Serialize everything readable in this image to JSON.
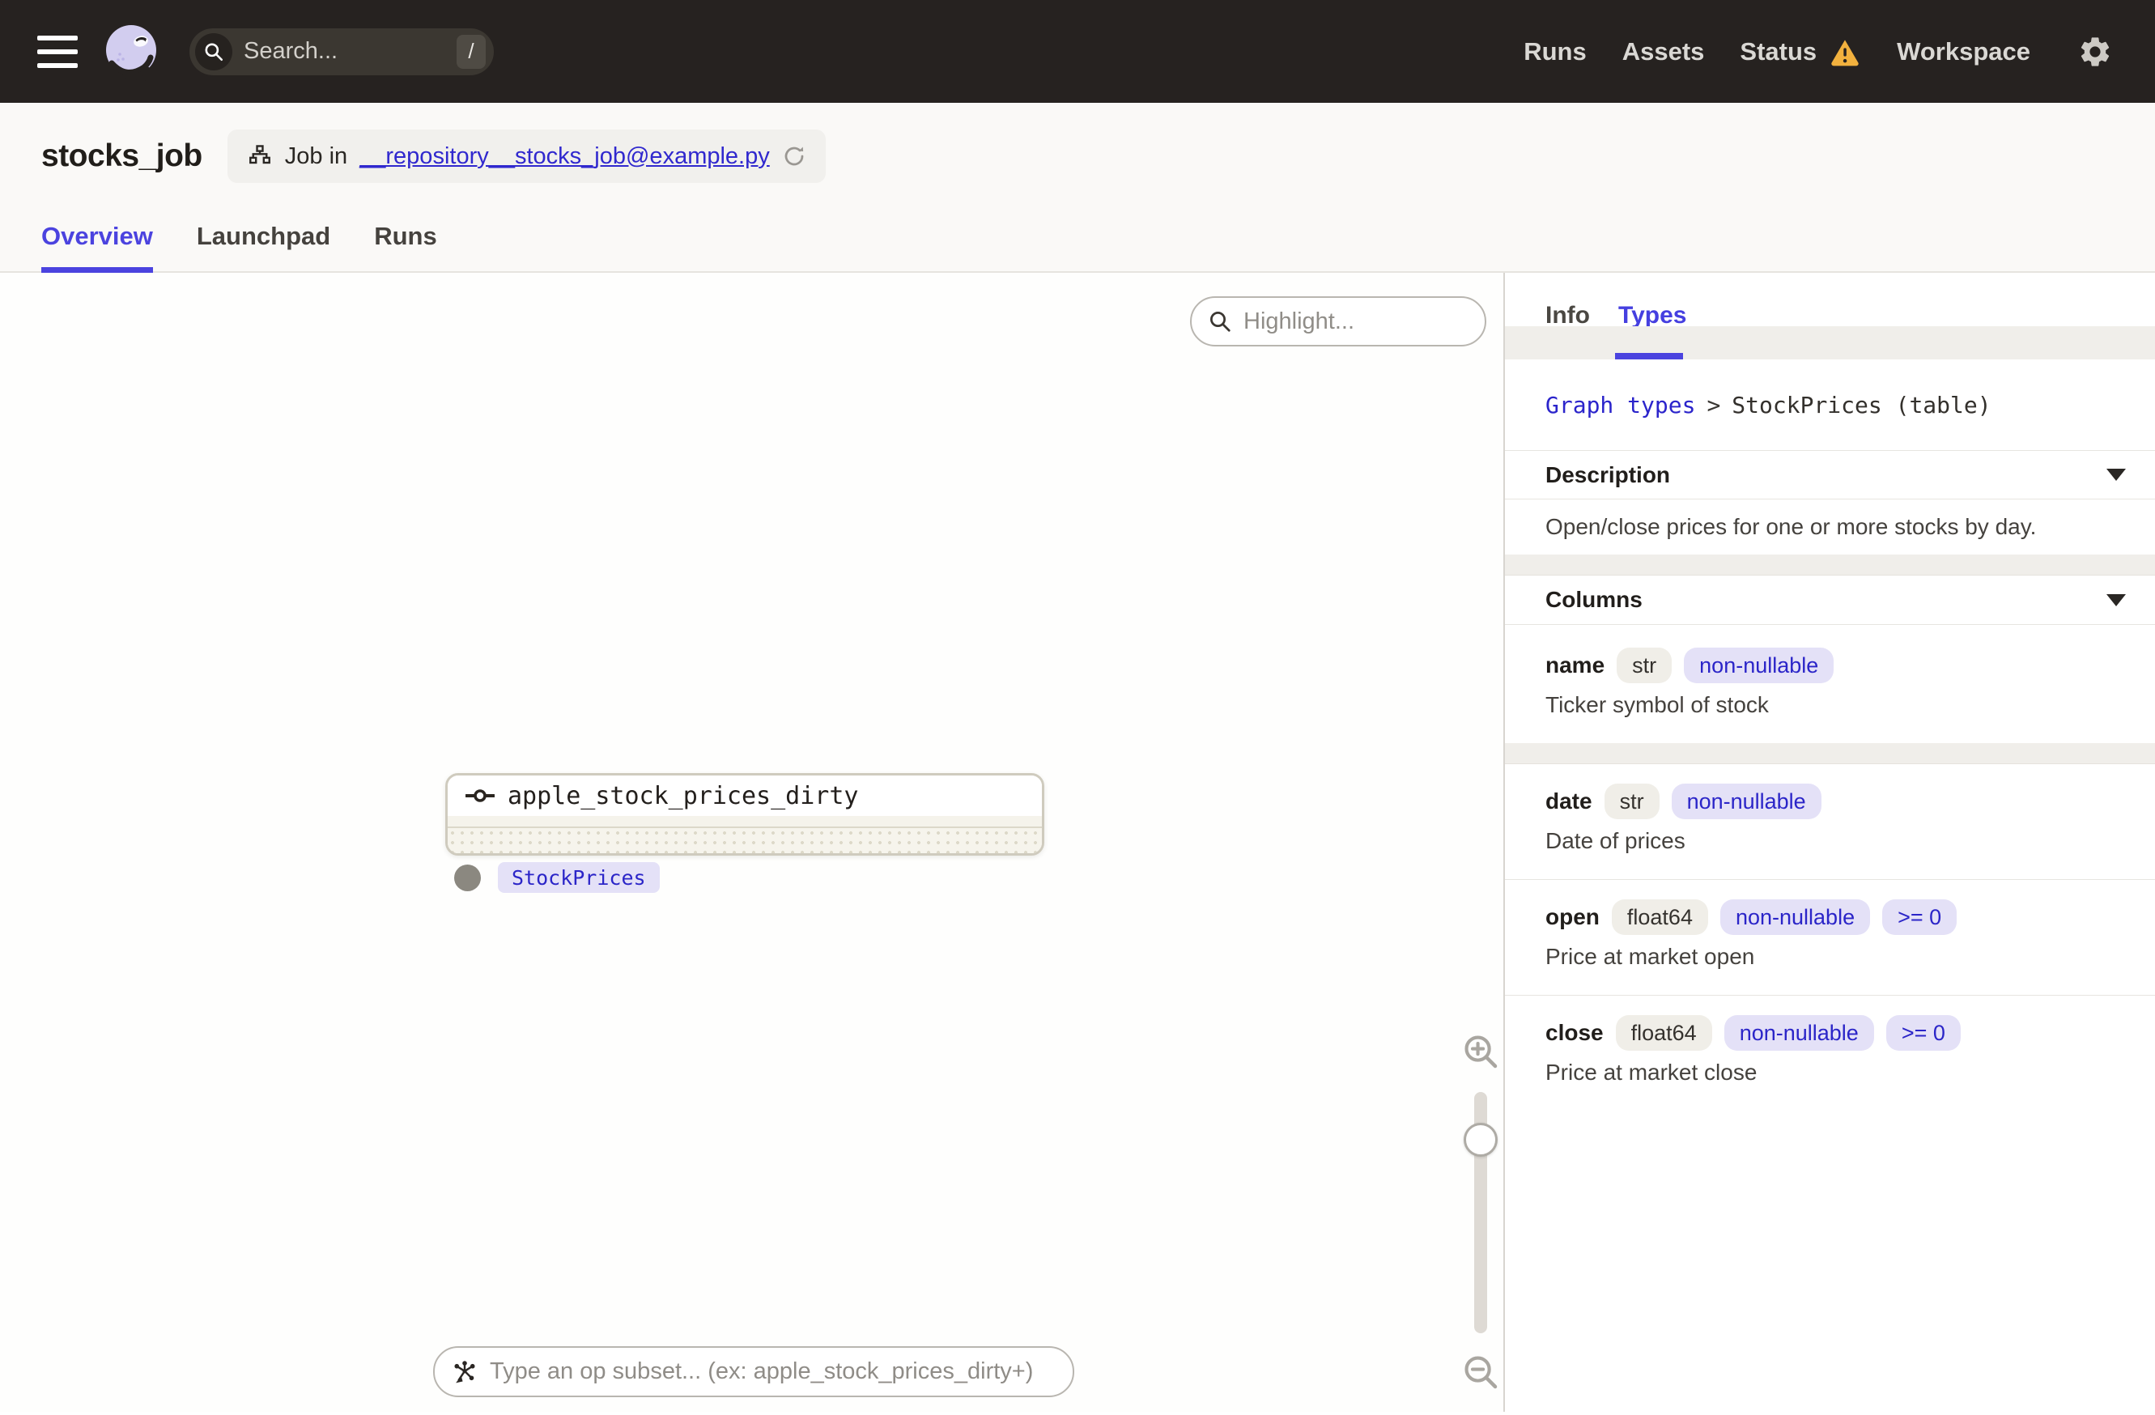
{
  "topbar": {
    "search": {
      "placeholder": "Search...",
      "shortcut": "/"
    },
    "nav": [
      {
        "label": "Runs"
      },
      {
        "label": "Assets"
      },
      {
        "label": "Status"
      },
      {
        "label": "Workspace"
      }
    ]
  },
  "page": {
    "title": "stocks_job",
    "job_badge": {
      "prefix": "Job in",
      "link": "__repository__stocks_job@example.py"
    },
    "tabs": [
      {
        "label": "Overview"
      },
      {
        "label": "Launchpad"
      },
      {
        "label": "Runs"
      }
    ]
  },
  "canvas": {
    "highlight_placeholder": "Highlight...",
    "node": {
      "name": "apple_stock_prices_dirty",
      "output_type": "StockPrices"
    },
    "op_subset_placeholder": "Type an op subset... (ex: apple_stock_prices_dirty+)"
  },
  "panel": {
    "tabs": [
      {
        "label": "Info"
      },
      {
        "label": "Types"
      }
    ],
    "breadcrumb": {
      "parent": "Graph types",
      "separator": ">",
      "current": "StockPrices (table)"
    },
    "description": {
      "title": "Description",
      "body": "Open/close prices for one or more stocks by day."
    },
    "columns_section": {
      "title": "Columns"
    },
    "columns": [
      {
        "name": "name",
        "type": "str",
        "constraints": [
          "non-nullable"
        ],
        "description": "Ticker symbol of stock"
      },
      {
        "name": "date",
        "type": "str",
        "constraints": [
          "non-nullable"
        ],
        "description": "Date of prices"
      },
      {
        "name": "open",
        "type": "float64",
        "constraints": [
          "non-nullable",
          ">= 0"
        ],
        "description": "Price at market open"
      },
      {
        "name": "close",
        "type": "float64",
        "constraints": [
          "non-nullable",
          ">= 0"
        ],
        "description": "Price at market close"
      }
    ]
  },
  "colors": {
    "topbar_bg": "#262220",
    "accent_indigo": "#4B43DF",
    "link_blue": "#2B24CB",
    "warning_amber": "#F2B13E",
    "badge_lavender_bg": "#E4E1F7",
    "badge_lavender_text": "#2B25C8",
    "badge_neutral_bg": "#F0EEE8"
  }
}
